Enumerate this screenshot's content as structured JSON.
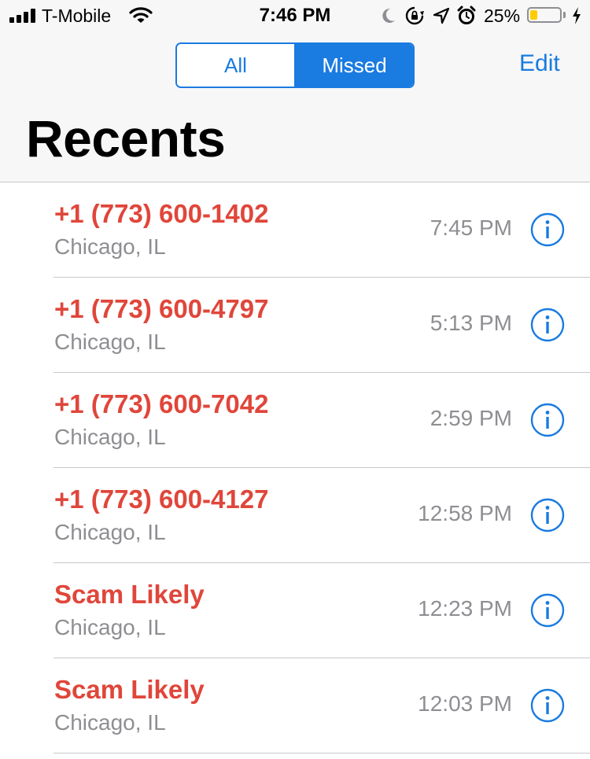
{
  "status_bar": {
    "carrier": "T-Mobile",
    "time": "7:46 PM",
    "battery_percent": "25%",
    "battery_level": 0.25,
    "icons": [
      "signal-icon",
      "wifi-icon",
      "moon-icon",
      "rotation-lock-icon",
      "location-icon",
      "alarm-icon",
      "battery-icon",
      "charging-bolt-icon"
    ]
  },
  "header": {
    "segments": [
      {
        "label": "All",
        "selected": false
      },
      {
        "label": "Missed",
        "selected": true
      }
    ],
    "edit_label": "Edit",
    "title": "Recents"
  },
  "calls": [
    {
      "name": "+1 (773) 600-1402",
      "location": "Chicago, IL",
      "time": "7:45 PM"
    },
    {
      "name": "+1 (773) 600-4797",
      "location": "Chicago, IL",
      "time": "5:13 PM"
    },
    {
      "name": "+1 (773) 600-7042",
      "location": "Chicago, IL",
      "time": "2:59 PM"
    },
    {
      "name": "+1 (773) 600-4127",
      "location": "Chicago, IL",
      "time": "12:58 PM"
    },
    {
      "name": "Scam Likely",
      "location": "Chicago, IL",
      "time": "12:23 PM"
    },
    {
      "name": "Scam Likely",
      "location": "Chicago, IL",
      "time": "12:03 PM"
    }
  ],
  "colors": {
    "accent": "#1a7be0",
    "missed_call": "#e0463a",
    "secondary_text": "#8e8e93",
    "battery_fill": "#ffcc00",
    "header_bg": "#f7f7f7"
  }
}
